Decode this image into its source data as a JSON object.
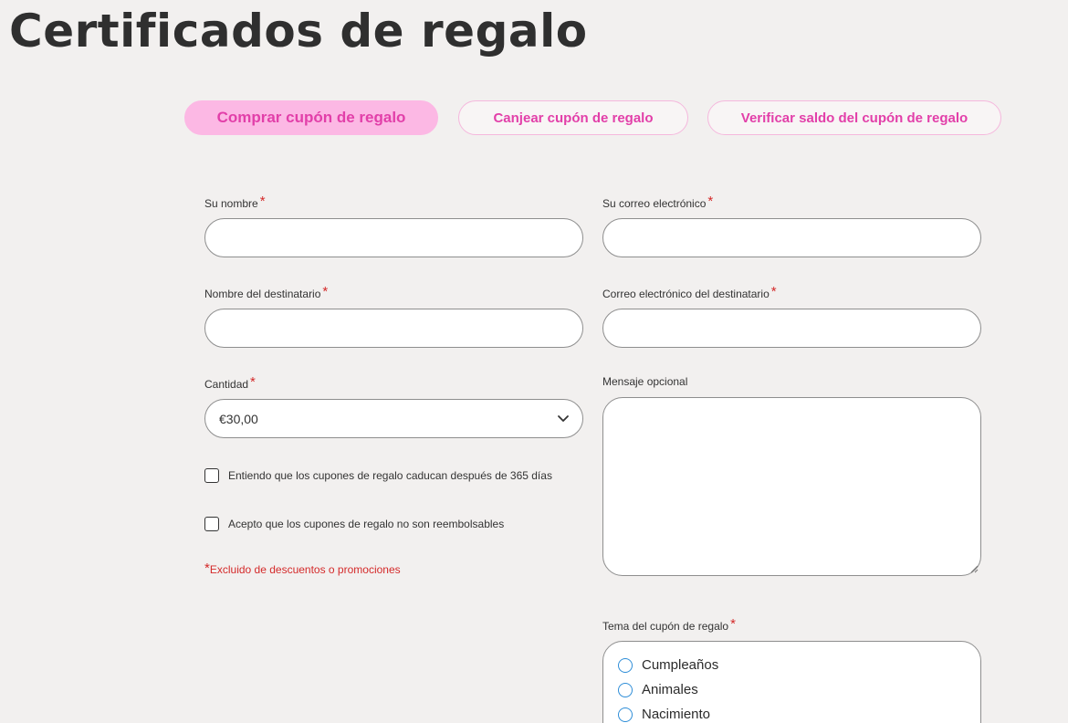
{
  "page": {
    "title": "Certificados de regalo"
  },
  "tabs": [
    {
      "label": "Comprar cupón de regalo",
      "active": true
    },
    {
      "label": "Canjear cupón de regalo",
      "active": false
    },
    {
      "label": "Verificar saldo del cupón de regalo",
      "active": false
    }
  ],
  "form": {
    "required_mark": "*",
    "your_name": {
      "label": "Su nombre",
      "value": ""
    },
    "your_email": {
      "label": "Su correo electrónico",
      "value": ""
    },
    "recipient_name": {
      "label": "Nombre del destinatario",
      "value": ""
    },
    "recipient_email": {
      "label": "Correo electrónico del destinatario",
      "value": ""
    },
    "amount": {
      "label": "Cantidad",
      "value": "€30,00"
    },
    "message": {
      "label": "Mensaje opcional",
      "value": ""
    },
    "checkboxes": [
      {
        "label": "Entiendo que los cupones de regalo caducan después de 365 días",
        "checked": false
      },
      {
        "label": "Acepto que los cupones de regalo no son reembolsables",
        "checked": false
      }
    ],
    "note": "Excluido de descuentos o promociones",
    "theme": {
      "label": "Tema del cupón de regalo",
      "options": [
        "Cumpleaños",
        "Animales",
        "Nacimiento"
      ]
    }
  },
  "icons": {
    "amount_dropdown": "chevron-down-icon",
    "textarea_resize": "resize-handle-icon"
  },
  "colors": {
    "background": "#f2f0ef",
    "accent_pink": "#e23fa9",
    "active_tab": "#fcb8e4",
    "required": "#d42a2a",
    "radio_border": "#2f8ed8"
  }
}
